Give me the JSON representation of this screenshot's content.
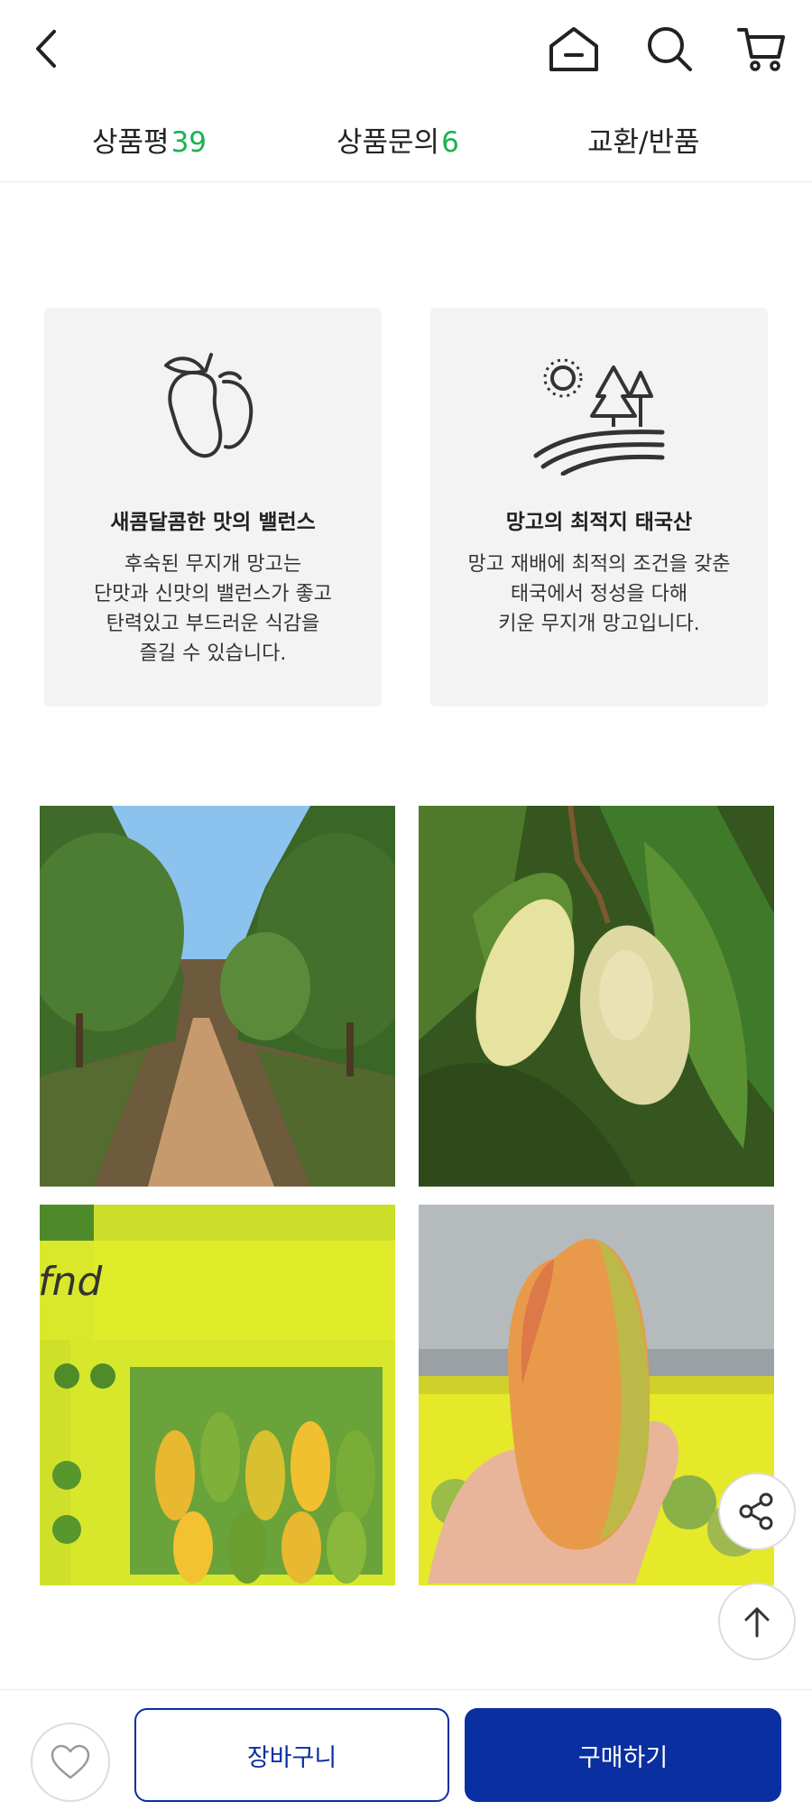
{
  "header": {
    "icons": [
      "back-icon",
      "home-icon",
      "search-icon",
      "cart-icon"
    ]
  },
  "tabs": [
    {
      "label": "상품평",
      "count": "39"
    },
    {
      "label": "상품문의",
      "count": "6"
    },
    {
      "label": "교환/반품",
      "count": ""
    }
  ],
  "features": [
    {
      "icon": "mango-icon",
      "title": "새콤달콤한 맛의 밸런스",
      "lines": [
        "후숙된 무지개 망고는",
        "단맛과 신맛의 밸런스가 좋고",
        "탄력있고 부드러운 식감을",
        "즐길 수 있습니다."
      ]
    },
    {
      "icon": "farm-landscape-icon",
      "title": "망고의 최적지 태국산",
      "lines": [
        "망고 재배에 최적의 조건을 갖춘",
        "태국에서 정성을 다해",
        "키운 무지개 망고입니다."
      ]
    }
  ],
  "photos": {
    "crate_label": "fnd"
  },
  "bottom": {
    "cart_label": "장바구니",
    "buy_label": "구매하기"
  },
  "colors": {
    "accent": "#0a2fa0",
    "count_green": "#19b34f",
    "card_bg": "#f3f3f3"
  }
}
